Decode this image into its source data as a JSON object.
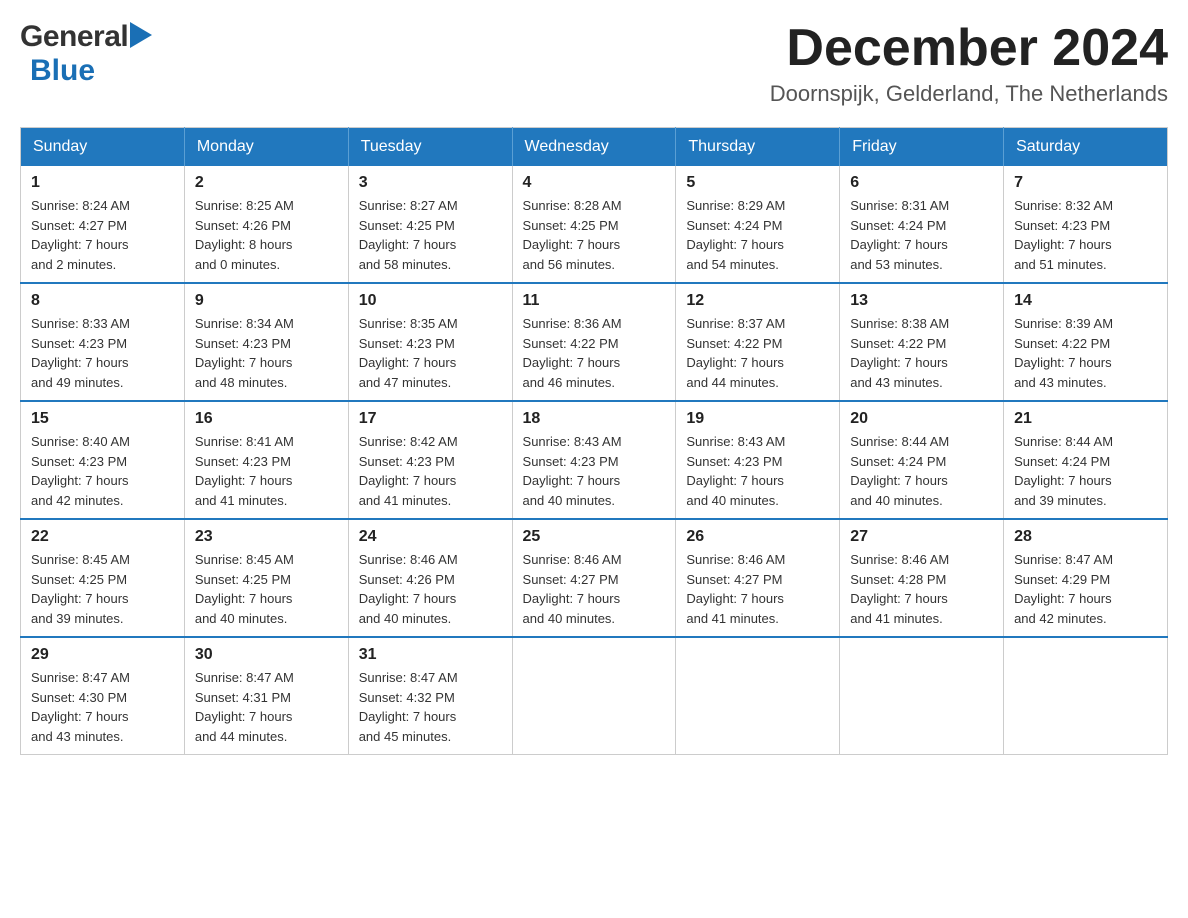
{
  "header": {
    "logo_general": "General",
    "logo_blue": "Blue",
    "month_year": "December 2024",
    "location": "Doornspijk, Gelderland, The Netherlands"
  },
  "days_of_week": [
    "Sunday",
    "Monday",
    "Tuesday",
    "Wednesday",
    "Thursday",
    "Friday",
    "Saturday"
  ],
  "weeks": [
    [
      {
        "day": "1",
        "sunrise": "Sunrise: 8:24 AM",
        "sunset": "Sunset: 4:27 PM",
        "daylight": "Daylight: 7 hours",
        "daylight2": "and 2 minutes."
      },
      {
        "day": "2",
        "sunrise": "Sunrise: 8:25 AM",
        "sunset": "Sunset: 4:26 PM",
        "daylight": "Daylight: 8 hours",
        "daylight2": "and 0 minutes."
      },
      {
        "day": "3",
        "sunrise": "Sunrise: 8:27 AM",
        "sunset": "Sunset: 4:25 PM",
        "daylight": "Daylight: 7 hours",
        "daylight2": "and 58 minutes."
      },
      {
        "day": "4",
        "sunrise": "Sunrise: 8:28 AM",
        "sunset": "Sunset: 4:25 PM",
        "daylight": "Daylight: 7 hours",
        "daylight2": "and 56 minutes."
      },
      {
        "day": "5",
        "sunrise": "Sunrise: 8:29 AM",
        "sunset": "Sunset: 4:24 PM",
        "daylight": "Daylight: 7 hours",
        "daylight2": "and 54 minutes."
      },
      {
        "day": "6",
        "sunrise": "Sunrise: 8:31 AM",
        "sunset": "Sunset: 4:24 PM",
        "daylight": "Daylight: 7 hours",
        "daylight2": "and 53 minutes."
      },
      {
        "day": "7",
        "sunrise": "Sunrise: 8:32 AM",
        "sunset": "Sunset: 4:23 PM",
        "daylight": "Daylight: 7 hours",
        "daylight2": "and 51 minutes."
      }
    ],
    [
      {
        "day": "8",
        "sunrise": "Sunrise: 8:33 AM",
        "sunset": "Sunset: 4:23 PM",
        "daylight": "Daylight: 7 hours",
        "daylight2": "and 49 minutes."
      },
      {
        "day": "9",
        "sunrise": "Sunrise: 8:34 AM",
        "sunset": "Sunset: 4:23 PM",
        "daylight": "Daylight: 7 hours",
        "daylight2": "and 48 minutes."
      },
      {
        "day": "10",
        "sunrise": "Sunrise: 8:35 AM",
        "sunset": "Sunset: 4:23 PM",
        "daylight": "Daylight: 7 hours",
        "daylight2": "and 47 minutes."
      },
      {
        "day": "11",
        "sunrise": "Sunrise: 8:36 AM",
        "sunset": "Sunset: 4:22 PM",
        "daylight": "Daylight: 7 hours",
        "daylight2": "and 46 minutes."
      },
      {
        "day": "12",
        "sunrise": "Sunrise: 8:37 AM",
        "sunset": "Sunset: 4:22 PM",
        "daylight": "Daylight: 7 hours",
        "daylight2": "and 44 minutes."
      },
      {
        "day": "13",
        "sunrise": "Sunrise: 8:38 AM",
        "sunset": "Sunset: 4:22 PM",
        "daylight": "Daylight: 7 hours",
        "daylight2": "and 43 minutes."
      },
      {
        "day": "14",
        "sunrise": "Sunrise: 8:39 AM",
        "sunset": "Sunset: 4:22 PM",
        "daylight": "Daylight: 7 hours",
        "daylight2": "and 43 minutes."
      }
    ],
    [
      {
        "day": "15",
        "sunrise": "Sunrise: 8:40 AM",
        "sunset": "Sunset: 4:23 PM",
        "daylight": "Daylight: 7 hours",
        "daylight2": "and 42 minutes."
      },
      {
        "day": "16",
        "sunrise": "Sunrise: 8:41 AM",
        "sunset": "Sunset: 4:23 PM",
        "daylight": "Daylight: 7 hours",
        "daylight2": "and 41 minutes."
      },
      {
        "day": "17",
        "sunrise": "Sunrise: 8:42 AM",
        "sunset": "Sunset: 4:23 PM",
        "daylight": "Daylight: 7 hours",
        "daylight2": "and 41 minutes."
      },
      {
        "day": "18",
        "sunrise": "Sunrise: 8:43 AM",
        "sunset": "Sunset: 4:23 PM",
        "daylight": "Daylight: 7 hours",
        "daylight2": "and 40 minutes."
      },
      {
        "day": "19",
        "sunrise": "Sunrise: 8:43 AM",
        "sunset": "Sunset: 4:23 PM",
        "daylight": "Daylight: 7 hours",
        "daylight2": "and 40 minutes."
      },
      {
        "day": "20",
        "sunrise": "Sunrise: 8:44 AM",
        "sunset": "Sunset: 4:24 PM",
        "daylight": "Daylight: 7 hours",
        "daylight2": "and 40 minutes."
      },
      {
        "day": "21",
        "sunrise": "Sunrise: 8:44 AM",
        "sunset": "Sunset: 4:24 PM",
        "daylight": "Daylight: 7 hours",
        "daylight2": "and 39 minutes."
      }
    ],
    [
      {
        "day": "22",
        "sunrise": "Sunrise: 8:45 AM",
        "sunset": "Sunset: 4:25 PM",
        "daylight": "Daylight: 7 hours",
        "daylight2": "and 39 minutes."
      },
      {
        "day": "23",
        "sunrise": "Sunrise: 8:45 AM",
        "sunset": "Sunset: 4:25 PM",
        "daylight": "Daylight: 7 hours",
        "daylight2": "and 40 minutes."
      },
      {
        "day": "24",
        "sunrise": "Sunrise: 8:46 AM",
        "sunset": "Sunset: 4:26 PM",
        "daylight": "Daylight: 7 hours",
        "daylight2": "and 40 minutes."
      },
      {
        "day": "25",
        "sunrise": "Sunrise: 8:46 AM",
        "sunset": "Sunset: 4:27 PM",
        "daylight": "Daylight: 7 hours",
        "daylight2": "and 40 minutes."
      },
      {
        "day": "26",
        "sunrise": "Sunrise: 8:46 AM",
        "sunset": "Sunset: 4:27 PM",
        "daylight": "Daylight: 7 hours",
        "daylight2": "and 41 minutes."
      },
      {
        "day": "27",
        "sunrise": "Sunrise: 8:46 AM",
        "sunset": "Sunset: 4:28 PM",
        "daylight": "Daylight: 7 hours",
        "daylight2": "and 41 minutes."
      },
      {
        "day": "28",
        "sunrise": "Sunrise: 8:47 AM",
        "sunset": "Sunset: 4:29 PM",
        "daylight": "Daylight: 7 hours",
        "daylight2": "and 42 minutes."
      }
    ],
    [
      {
        "day": "29",
        "sunrise": "Sunrise: 8:47 AM",
        "sunset": "Sunset: 4:30 PM",
        "daylight": "Daylight: 7 hours",
        "daylight2": "and 43 minutes."
      },
      {
        "day": "30",
        "sunrise": "Sunrise: 8:47 AM",
        "sunset": "Sunset: 4:31 PM",
        "daylight": "Daylight: 7 hours",
        "daylight2": "and 44 minutes."
      },
      {
        "day": "31",
        "sunrise": "Sunrise: 8:47 AM",
        "sunset": "Sunset: 4:32 PM",
        "daylight": "Daylight: 7 hours",
        "daylight2": "and 45 minutes."
      },
      null,
      null,
      null,
      null
    ]
  ]
}
